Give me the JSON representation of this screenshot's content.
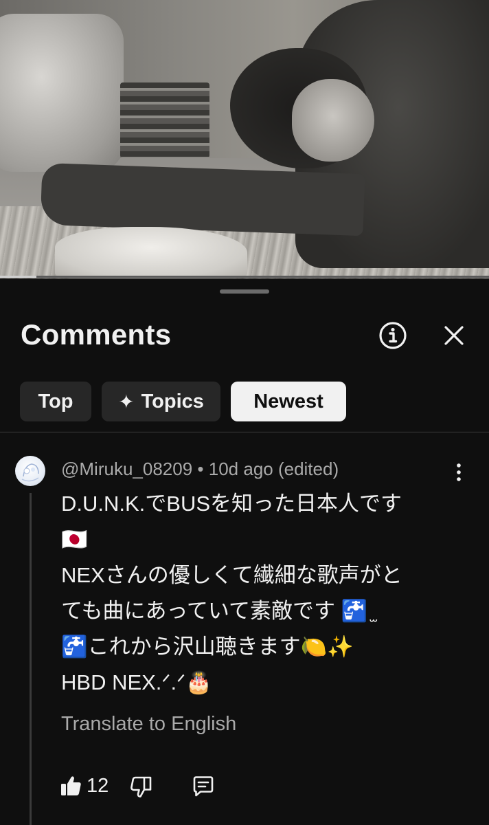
{
  "video": {
    "progress_fraction": 0.075
  },
  "comments_panel": {
    "title": "Comments",
    "info_icon": "info-icon",
    "close_icon": "close-icon",
    "filters": [
      {
        "label": "Top",
        "active": false
      },
      {
        "label": "Topics",
        "icon": "sparkle-icon",
        "active": false
      },
      {
        "label": "Newest",
        "active": true
      }
    ]
  },
  "comment": {
    "author": "@Miruku_08209",
    "separator": "•",
    "age": "10d ago (edited)",
    "lines": [
      "D.U.N.K.でBUSを知った日本人です",
      "🇯🇵",
      "NEXさんの優しくて繊細な歌声がと",
      "ても曲にあっていて素敵です 🚰 ̫",
      "🚰これから沢山聴きます🍋✨",
      "HBD NEX.ᐟ.ᐟ🎂"
    ],
    "translate_label": "Translate to English",
    "like_count": "12"
  },
  "colors": {
    "background": "#0f0f0f",
    "chip": "#272727",
    "chip_active": "#f1f1f1",
    "secondary_text": "#aaaaaa"
  }
}
